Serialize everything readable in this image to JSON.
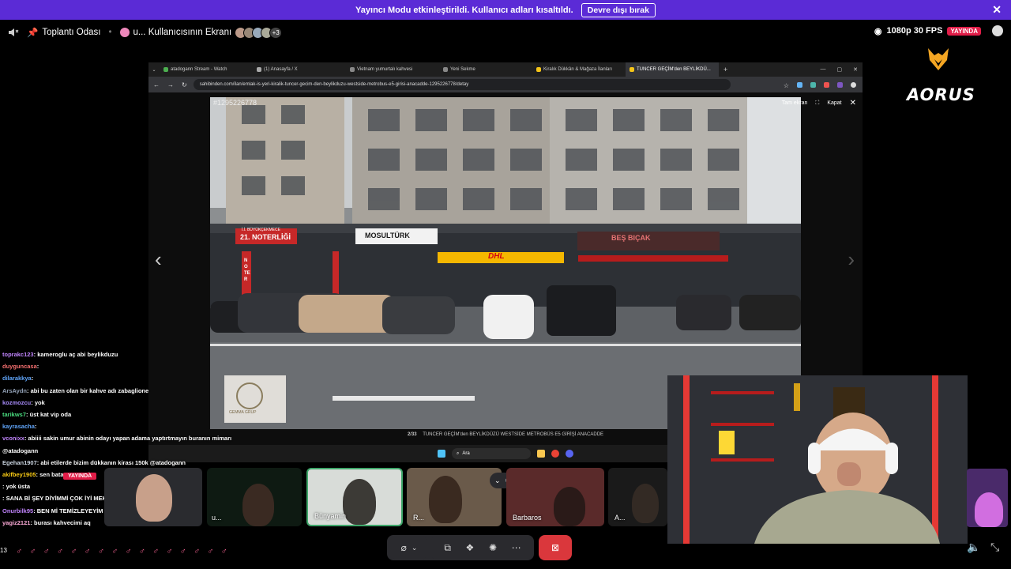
{
  "banner": {
    "text": "Yayıncı Modu etkinleştirildi. Kullanıcı adları kısaltıldı.",
    "button": "Devre dışı bırak",
    "close": "✕"
  },
  "topbar": {
    "channel": "Toplantı Odası",
    "screen_owner": "u... Kullanıcısının Ekranı",
    "more_viewers": "+3",
    "quality": "1080p 30 FPS",
    "live": "YAYINDA"
  },
  "brand": {
    "name": "AORUS"
  },
  "browser": {
    "tabs": [
      {
        "label": "atadogann Stream - Watch"
      },
      {
        "label": "(1) Anasayfa / X"
      },
      {
        "label": "Vietnam yumurtalı kahvesi"
      },
      {
        "label": "Yeni Sekme"
      },
      {
        "label": "Kiralık Dükkân & Mağaza İlanları"
      },
      {
        "label": "TUNCER GEÇİM'den BEYLİKDÜ..."
      }
    ],
    "url": "sahibinden.com/ilan/emlak-is-yeri-kiralik-tuncer-gecim-den-beylikduzu-westside-metrobus-e5-girisi-anacadde-1295226778/detay",
    "photo_id": "#1295226778",
    "fullscreen_label": "Tam ekran",
    "close_label": "Kapat",
    "counter": "2/33",
    "caption": "TUNCER GEÇİM'den BEYLİKDÜZÜ WESTSİDE METROBÜS E5 GİRİŞİ ANACADDE",
    "taskbar_search": "Ara",
    "signs": {
      "noter": "21. NOTERLİĞİ",
      "noter_top": "İ.İ. BÜYÜKÇEKMECE",
      "musulturk": "MOSULTÜRK",
      "dhl": "DHL",
      "besbicak": "BEŞ BIÇAK",
      "noter_vertical": "NOTER",
      "watermark": "GEMMA GRUP"
    }
  },
  "chat": {
    "messages": [
      {
        "user": "toprakc123",
        "color": "#c084fc",
        "text": ": kameroglu aç abi beylikduzu"
      },
      {
        "user": "duyguncasa",
        "color": "#f87171",
        "text": ":"
      },
      {
        "user": "dilarakkya",
        "color": "#60a5fa",
        "text": ":"
      },
      {
        "user": "ArsAydn",
        "color": "#94a3b8",
        "text": ": abi bu zaten olan bir kahve adı zabaglione"
      },
      {
        "user": "kozmozcu",
        "color": "#a78bfa",
        "text": ": yok"
      },
      {
        "user": "tarikws7",
        "color": "#4ade80",
        "text": ": üst kat vip oda"
      },
      {
        "user": "kayrasacha",
        "color": "#60a5fa",
        "text": ":"
      },
      {
        "user": "vconixx",
        "color": "#c084fc",
        "text": ": abiiii sakin umur abinin odayı yapan adama yaptırtmayın buranın mimarı"
      },
      {
        "user": "",
        "color": "#93c5fd",
        "text": "@atadogann"
      },
      {
        "user": "Egehan1907",
        "color": "#cbd5e1",
        "text": ": abi etilerde bizim dükkanın kirası 150k @atadogann"
      },
      {
        "user": "akifbey1905",
        "color": "#facc15",
        "text": ": sen batarmısın mk"
      },
      {
        "user": "",
        "color": "#f87171",
        "text": ""
      },
      {
        "user": "",
        "color": "#f87171",
        "text": ""
      },
      {
        "user": "",
        "color": "#f87171",
        "text": ": yok üsta"
      },
      {
        "user": "",
        "color": "#f87171",
        "text": ": SANA Bİ ŞEY DİYİMMİ ÇOK İYİ MEKAN AW"
      },
      {
        "user": "Onurbilk95",
        "color": "#c084fc",
        "text": ": BEN Mİ TEMİZLEYEYİM AYSU SEN TEMİZLİCEN TABİ"
      },
      {
        "user": "yagiz2121",
        "color": "#f9a8d4",
        "text": ": burası kahvecimi aq"
      }
    ],
    "footer_counter": "13",
    "tile_live": "YAYINDA"
  },
  "participants": [
    {
      "name": "u...",
      "color": "#1f2a24"
    },
    {
      "name": "Bünyamin",
      "color": "#d8dcd8"
    },
    {
      "name": "R...",
      "color": "#6a5a4a"
    },
    {
      "name": "Barbaros",
      "color": "#5a2a2a"
    },
    {
      "name": "A...",
      "color": "#1a1a1a"
    }
  ],
  "controls": {
    "mic": "mic-icon",
    "camera": "camera-off-icon",
    "share": "share-screen-icon",
    "activities": "activities-icon",
    "soundboard": "soundboard-icon",
    "more": "more-icon",
    "leave": "leave-call-icon"
  }
}
